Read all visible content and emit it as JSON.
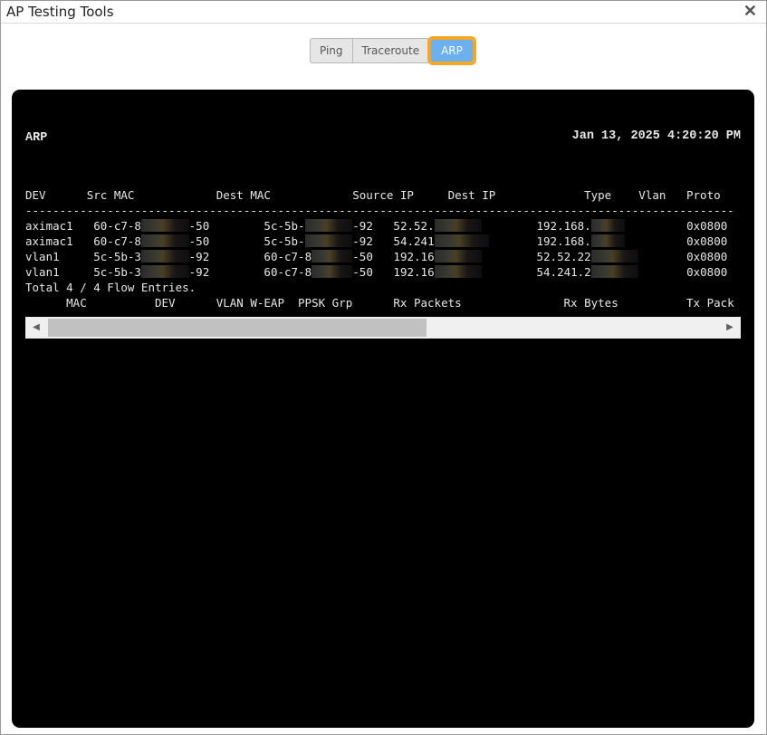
{
  "window": {
    "title": "AP Testing Tools",
    "close_icon": "close-icon"
  },
  "tabs": [
    {
      "label": "Ping"
    },
    {
      "label": "Traceroute"
    },
    {
      "label": "ARP",
      "active": true
    }
  ],
  "terminal": {
    "heading": "ARP",
    "timestamp": "Jan 13, 2025 4:20:20 PM",
    "lines": [
      [
        {
          "t": "DEV      Src MAC            Dest MAC            Source IP     Dest IP             Type    Vlan   Proto"
        }
      ],
      [
        {
          "t": "--------------------------------------------------------------------------------------------------------"
        }
      ],
      [
        {
          "t": "aximac1   60-c7-8"
        },
        {
          "m": 7
        },
        {
          "t": "-50        5c-5b-"
        },
        {
          "m": 7
        },
        {
          "t": "-92   52.52."
        },
        {
          "m": 7
        },
        {
          "t": "        192.168."
        },
        {
          "m": 5
        },
        {
          "t": "         0x0800"
        }
      ],
      [
        {
          "t": "aximac1   60-c7-8"
        },
        {
          "m": 7
        },
        {
          "t": "-50        5c-5b-"
        },
        {
          "m": 7
        },
        {
          "t": "-92   54.241"
        },
        {
          "m": 8
        },
        {
          "t": "       192.168."
        },
        {
          "m": 5
        },
        {
          "t": "         0x0800"
        }
      ],
      [
        {
          "t": "vlan1     5c-5b-3"
        },
        {
          "m": 7
        },
        {
          "t": "-92        60-c7-8"
        },
        {
          "m": 6
        },
        {
          "t": "-50   192.16"
        },
        {
          "m": 7
        },
        {
          "t": "        52.52.22"
        },
        {
          "m": 7
        },
        {
          "t": "       0x0800"
        }
      ],
      [
        {
          "t": "vlan1     5c-5b-3"
        },
        {
          "m": 7
        },
        {
          "t": "-92        60-c7-8"
        },
        {
          "m": 6
        },
        {
          "t": "-50   192.16"
        },
        {
          "m": 7
        },
        {
          "t": "        54.241.2"
        },
        {
          "m": 7
        },
        {
          "t": "       0x0800"
        }
      ],
      [
        {
          "t": "Total 4 / 4 Flow Entries."
        }
      ],
      [
        {
          "t": "      MAC          DEV      VLAN W-EAP  PPSK Grp      Rx Packets               Rx Bytes          Tx Pack"
        }
      ],
      [
        {
          "t": "--------------------------------------------------------------------------------------------------------"
        }
      ],
      [
        {
          "t": "60-c7-8d-"
        },
        {
          "m": 7
        },
        {
          "t": "0     aximac1[0]  1       ALOW           0        2616566                402115364"
        }
      ],
      [
        {
          "t": "5c-5b-35-"
        },
        {
          "m": 7
        },
        {
          "t": "2     vlan1       1       ALOW           0        6155652               2345914239"
        }
      ],
      [
        {
          "t": "90-ec-77-"
        },
        {
          "m": 7
        },
        {
          "t": "b     aximac1[0]  1       ALOW           0        1650661                105642804"
        }
      ],
      [
        {
          "t": "Total 3 MAC Entries."
        }
      ]
    ]
  }
}
